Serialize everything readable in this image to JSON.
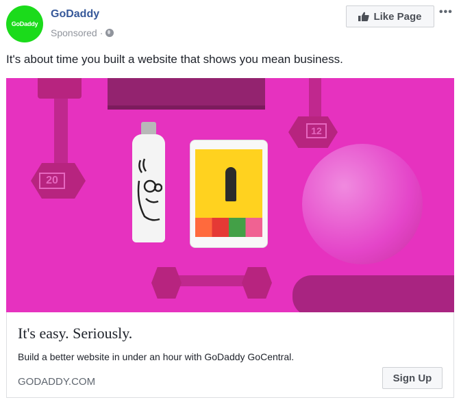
{
  "header": {
    "avatar_text": "GoDaddy",
    "page_name": "GoDaddy",
    "sponsored_label": "Sponsored",
    "separator": "·",
    "like_page_label": "Like Page",
    "more_label": "•••"
  },
  "post": {
    "text": "It's about time you built a website that shows you mean business."
  },
  "ad_image": {
    "dumbbell_left_label": "20",
    "dumbbell_right_label": "12"
  },
  "link_card": {
    "headline": "It's easy. Seriously.",
    "description": "Build a better website in under an hour with GoDaddy GoCentral.",
    "domain": "GODADDY.COM",
    "cta_label": "Sign Up"
  },
  "colors": {
    "brand_green": "#1bdb1b",
    "link_blue": "#365899",
    "image_pink": "#e632bf"
  },
  "icons": [
    "globe-icon",
    "thumbs-up-icon",
    "more-options-icon"
  ]
}
